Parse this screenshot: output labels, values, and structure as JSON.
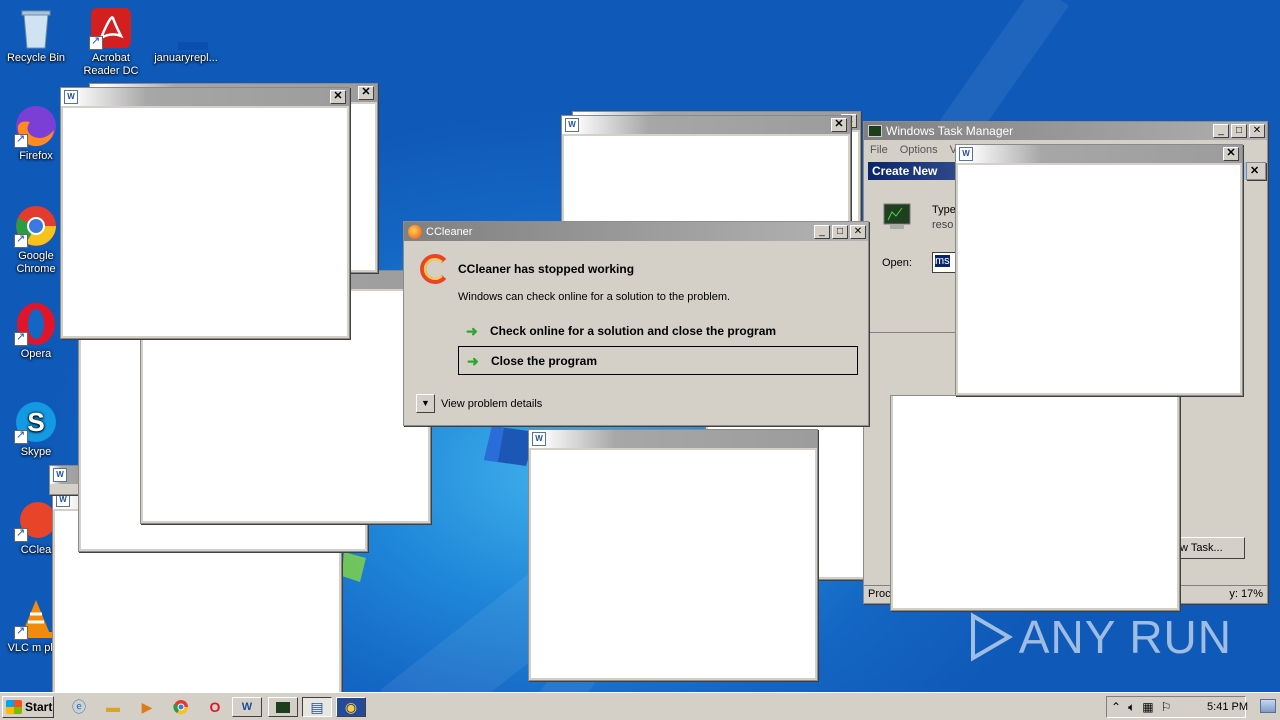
{
  "desktop": {
    "icons": [
      {
        "label": "Recycle Bin"
      },
      {
        "label": "Acrobat Reader DC"
      },
      {
        "label": "januaryrepl..."
      },
      {
        "label": "Firefox"
      },
      {
        "label": "Google Chrome"
      },
      {
        "label": "Opera"
      },
      {
        "label": "Skype"
      },
      {
        "label": "CClea"
      },
      {
        "label": "VLC m play"
      }
    ],
    "watermark": "ANY RUN"
  },
  "ccleaner_dialog": {
    "title": "CCleaner",
    "heading": "CCleaner has stopped working",
    "subtext": "Windows can check online for a solution to the problem.",
    "option_check_online": "Check online for a solution and close the program",
    "option_close": "Close the program",
    "details_label": "View problem details"
  },
  "task_manager": {
    "title": "Windows Task Manager",
    "menu": [
      "File",
      "Options",
      "V"
    ],
    "create_new_title": "Create New",
    "type_text": "Type",
    "reso_text": "reso",
    "open_label": "Open:",
    "open_value": "ms",
    "new_task_button": "New Task...",
    "status_processes": "Proce",
    "status_cpu": "y: 17%"
  },
  "taskbar": {
    "start_label": "Start",
    "clock": "5:41 PM"
  },
  "colors": {
    "desktop_blue": "#1466c4",
    "titlebar_gray": "#9c9c9c",
    "dialog_bg": "#d4d0c8",
    "arrow_green": "#2fa52f"
  }
}
